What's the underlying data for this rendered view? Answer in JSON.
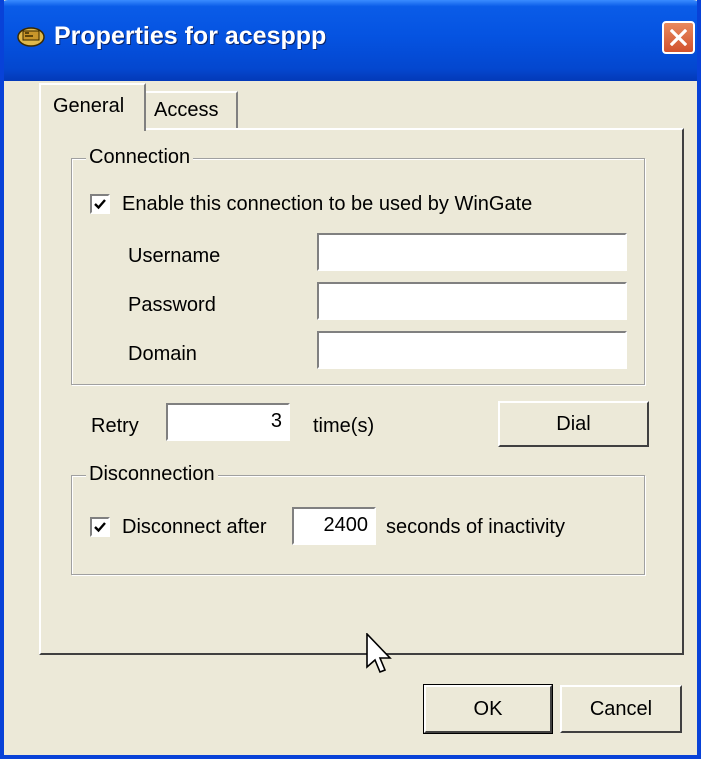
{
  "window": {
    "title": "Properties for acesppp",
    "close_icon": "close-x-icon",
    "app_icon": "wingate-app-icon"
  },
  "tabs": [
    {
      "label": "General",
      "selected": true
    },
    {
      "label": "Access",
      "selected": false
    }
  ],
  "connection": {
    "legend": "Connection",
    "enable_label": "Enable this connection to be used by WinGate",
    "enable_checked": true,
    "fields": [
      {
        "label": "Username",
        "value": ""
      },
      {
        "label": "Password",
        "value": ""
      },
      {
        "label": "Domain",
        "value": ""
      }
    ]
  },
  "retry": {
    "label": "Retry",
    "value": "3",
    "unit": "time(s)",
    "dial_label": "Dial"
  },
  "disconnection": {
    "legend": "Disconnection",
    "checkbox_label": "Disconnect after",
    "checked": true,
    "seconds": "2400",
    "suffix": "seconds of inactivity"
  },
  "buttons": {
    "ok": "OK",
    "cancel": "Cancel"
  },
  "colors": {
    "titlebar": "#0553e1",
    "dialog_bg": "#ece9d8",
    "close_button": "#d2522e"
  }
}
